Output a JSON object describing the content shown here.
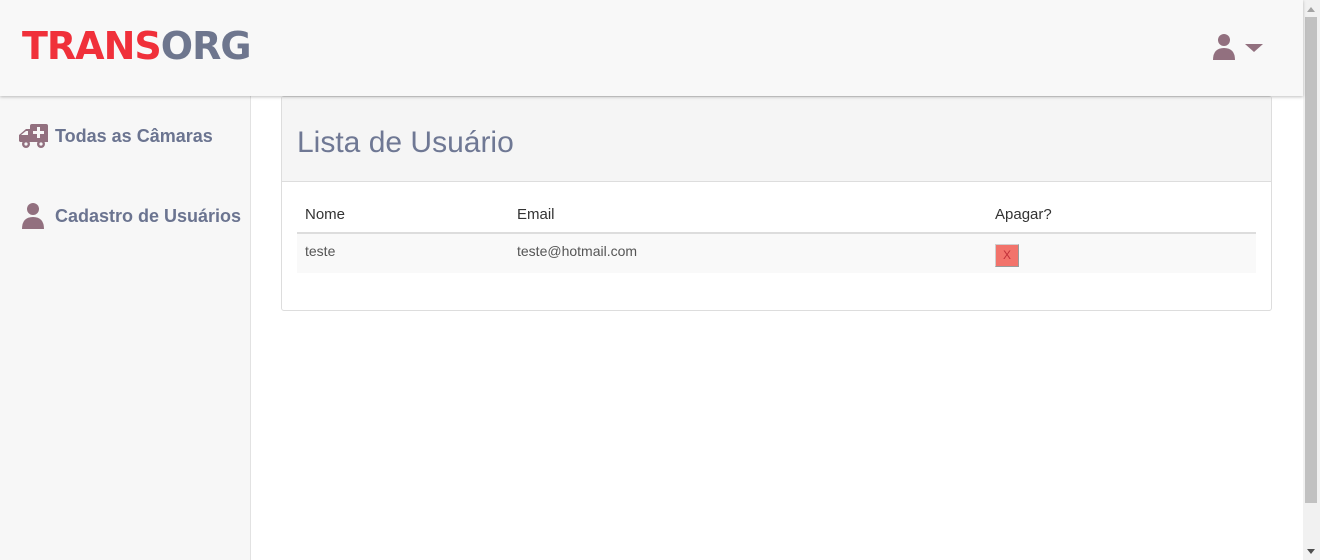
{
  "header": {
    "logo_part1": "TRANS",
    "logo_part2": "ORG",
    "user_icon": "user-icon",
    "dropdown_icon": "caret-down-icon"
  },
  "sidebar": {
    "items": [
      {
        "label": "Todas as Câmaras",
        "icon": "ambulance-icon"
      },
      {
        "label": "Cadastro de Usuários",
        "icon": "user-icon"
      }
    ]
  },
  "main": {
    "title": "Lista de Usuário",
    "table": {
      "headers": [
        "Nome",
        "Email",
        "Apagar?"
      ],
      "rows": [
        {
          "nome": "teste",
          "email": "teste@hotmail.com",
          "delete_label": "X"
        }
      ]
    }
  },
  "colors": {
    "brand_red": "#f0303a",
    "brand_gray": "#6e768e",
    "icon_mauve": "#92707f",
    "delete_button": "#f2736b"
  }
}
